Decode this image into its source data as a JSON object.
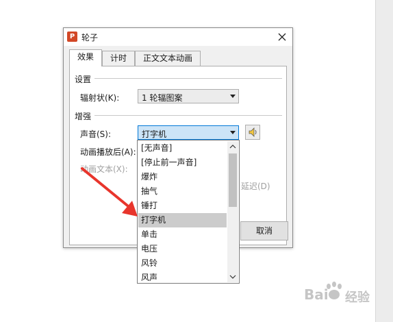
{
  "dialog": {
    "icon_letter": "P",
    "title": "轮子",
    "tabs": [
      {
        "label": "效果",
        "active": true
      },
      {
        "label": "计时",
        "active": false
      },
      {
        "label": "正文文本动画",
        "active": false
      }
    ],
    "settings": {
      "group_label": "设置",
      "spokes_label": "辐射状(K):",
      "spokes_value": "1 轮辐图案"
    },
    "enhance": {
      "group_label": "增强",
      "sound_label": "声音(S):",
      "sound_value": "打字机",
      "after_anim_label": "动画播放后(A):",
      "anim_text_label": "动画文本(X):",
      "delay_suffix": "延迟(D)"
    },
    "cancel_label": "取消"
  },
  "dropdown": {
    "items": [
      {
        "label": "[无声音]",
        "selected": false
      },
      {
        "label": "[停止前一声音]",
        "selected": false
      },
      {
        "label": "爆炸",
        "selected": false
      },
      {
        "label": "抽气",
        "selected": false
      },
      {
        "label": "锤打",
        "selected": false
      },
      {
        "label": "打字机",
        "selected": true
      },
      {
        "label": "单击",
        "selected": false
      },
      {
        "label": "电压",
        "selected": false
      },
      {
        "label": "风铃",
        "selected": false
      },
      {
        "label": "风声",
        "selected": false
      }
    ]
  },
  "annotation": {
    "arrow_color": "#e8352c"
  },
  "watermark": {
    "brand": "Bai",
    "suffix": "经验"
  },
  "icons": {
    "close": "close-icon",
    "speaker": "speaker-icon",
    "scroll_up": "chevron-up-icon",
    "scroll_down": "chevron-down-icon"
  }
}
